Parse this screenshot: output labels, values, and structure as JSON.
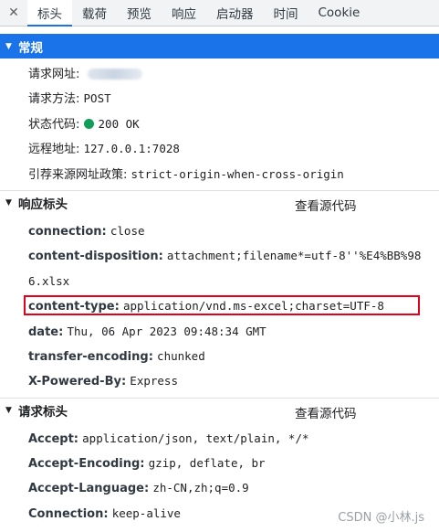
{
  "tabs": [
    "标头",
    "载荷",
    "预览",
    "响应",
    "启动器",
    "时间",
    "Cookie"
  ],
  "tab_close": "✕",
  "general": {
    "title": "常规",
    "rows": [
      {
        "key": "请求网址:",
        "value": ""
      },
      {
        "key": "请求方法:",
        "value": "POST"
      },
      {
        "key": "状态代码:",
        "value": "200 OK"
      },
      {
        "key": "远程地址:",
        "value": "127.0.0.1:7028"
      },
      {
        "key": "引荐来源网址政策:",
        "value": "strict-origin-when-cross-origin"
      }
    ]
  },
  "response_headers": {
    "title": "响应标头",
    "view_source": "查看源代码",
    "rows": [
      {
        "key": "connection:",
        "value": "close"
      },
      {
        "key": "content-disposition:",
        "value": "attachment;filename*=utf-8''%E4%BB%98"
      },
      {
        "key": "",
        "value": "6.xlsx"
      },
      {
        "key": "content-type:",
        "value": "application/vnd.ms-excel;charset=UTF-8"
      },
      {
        "key": "date:",
        "value": "Thu, 06 Apr 2023 09:48:34 GMT"
      },
      {
        "key": "transfer-encoding:",
        "value": "chunked"
      },
      {
        "key": "X-Powered-By:",
        "value": "Express"
      }
    ]
  },
  "request_headers": {
    "title": "请求标头",
    "view_source": "查看源代码",
    "rows": [
      {
        "key": "Accept:",
        "value": "application/json, text/plain, */*"
      },
      {
        "key": "Accept-Encoding:",
        "value": "gzip, deflate, br"
      },
      {
        "key": "Accept-Language:",
        "value": "zh-CN,zh;q=0.9"
      },
      {
        "key": "Connection:",
        "value": "keep-alive"
      }
    ]
  },
  "watermark": "CSDN @小林.js",
  "colors": {
    "accent": "#1a73e8",
    "status_ok": "#0f9d58",
    "highlight": "#e3001b"
  }
}
